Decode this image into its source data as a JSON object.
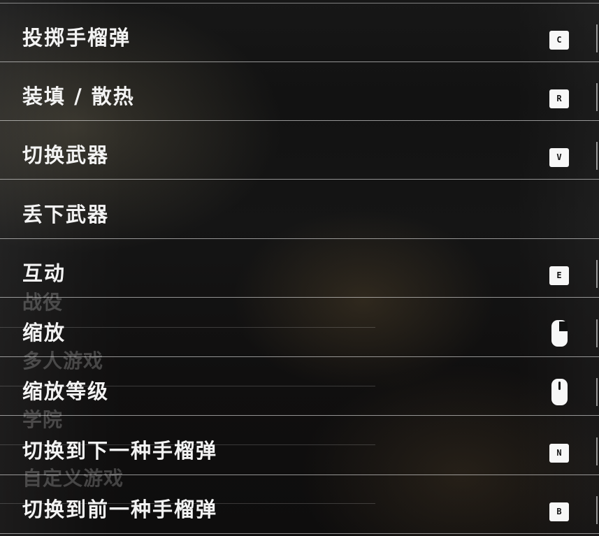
{
  "background_menu": {
    "items": [
      "战役",
      "多人游戏",
      "学院",
      "自定义游戏"
    ]
  },
  "bindings": {
    "rows": [
      {
        "label": "投掷手榴弹",
        "key": "C",
        "icon": "keycap-c-icon"
      },
      {
        "label": "装填 / 散热",
        "key": "R",
        "icon": "keycap-r-icon"
      },
      {
        "label": "切换武器",
        "key": "V",
        "icon": "keycap-v-icon"
      },
      {
        "label": "丢下武器",
        "key": ""
      },
      {
        "label": "互动",
        "key": "E",
        "icon": "keycap-e-icon"
      },
      {
        "label": "缩放",
        "icon": "mouse-right-button-icon"
      },
      {
        "label": "缩放等级",
        "icon": "mouse-wheel-icon"
      },
      {
        "label": "切换到下一种手榴弹",
        "key": "N",
        "icon": "keycap-n-icon"
      },
      {
        "label": "切换到前一种手榴弹",
        "key": "B",
        "icon": "keycap-b-icon"
      }
    ]
  },
  "colors": {
    "text": "#f3f3f3",
    "divider": "#ffffff",
    "keycap": "#f7f7f7"
  }
}
